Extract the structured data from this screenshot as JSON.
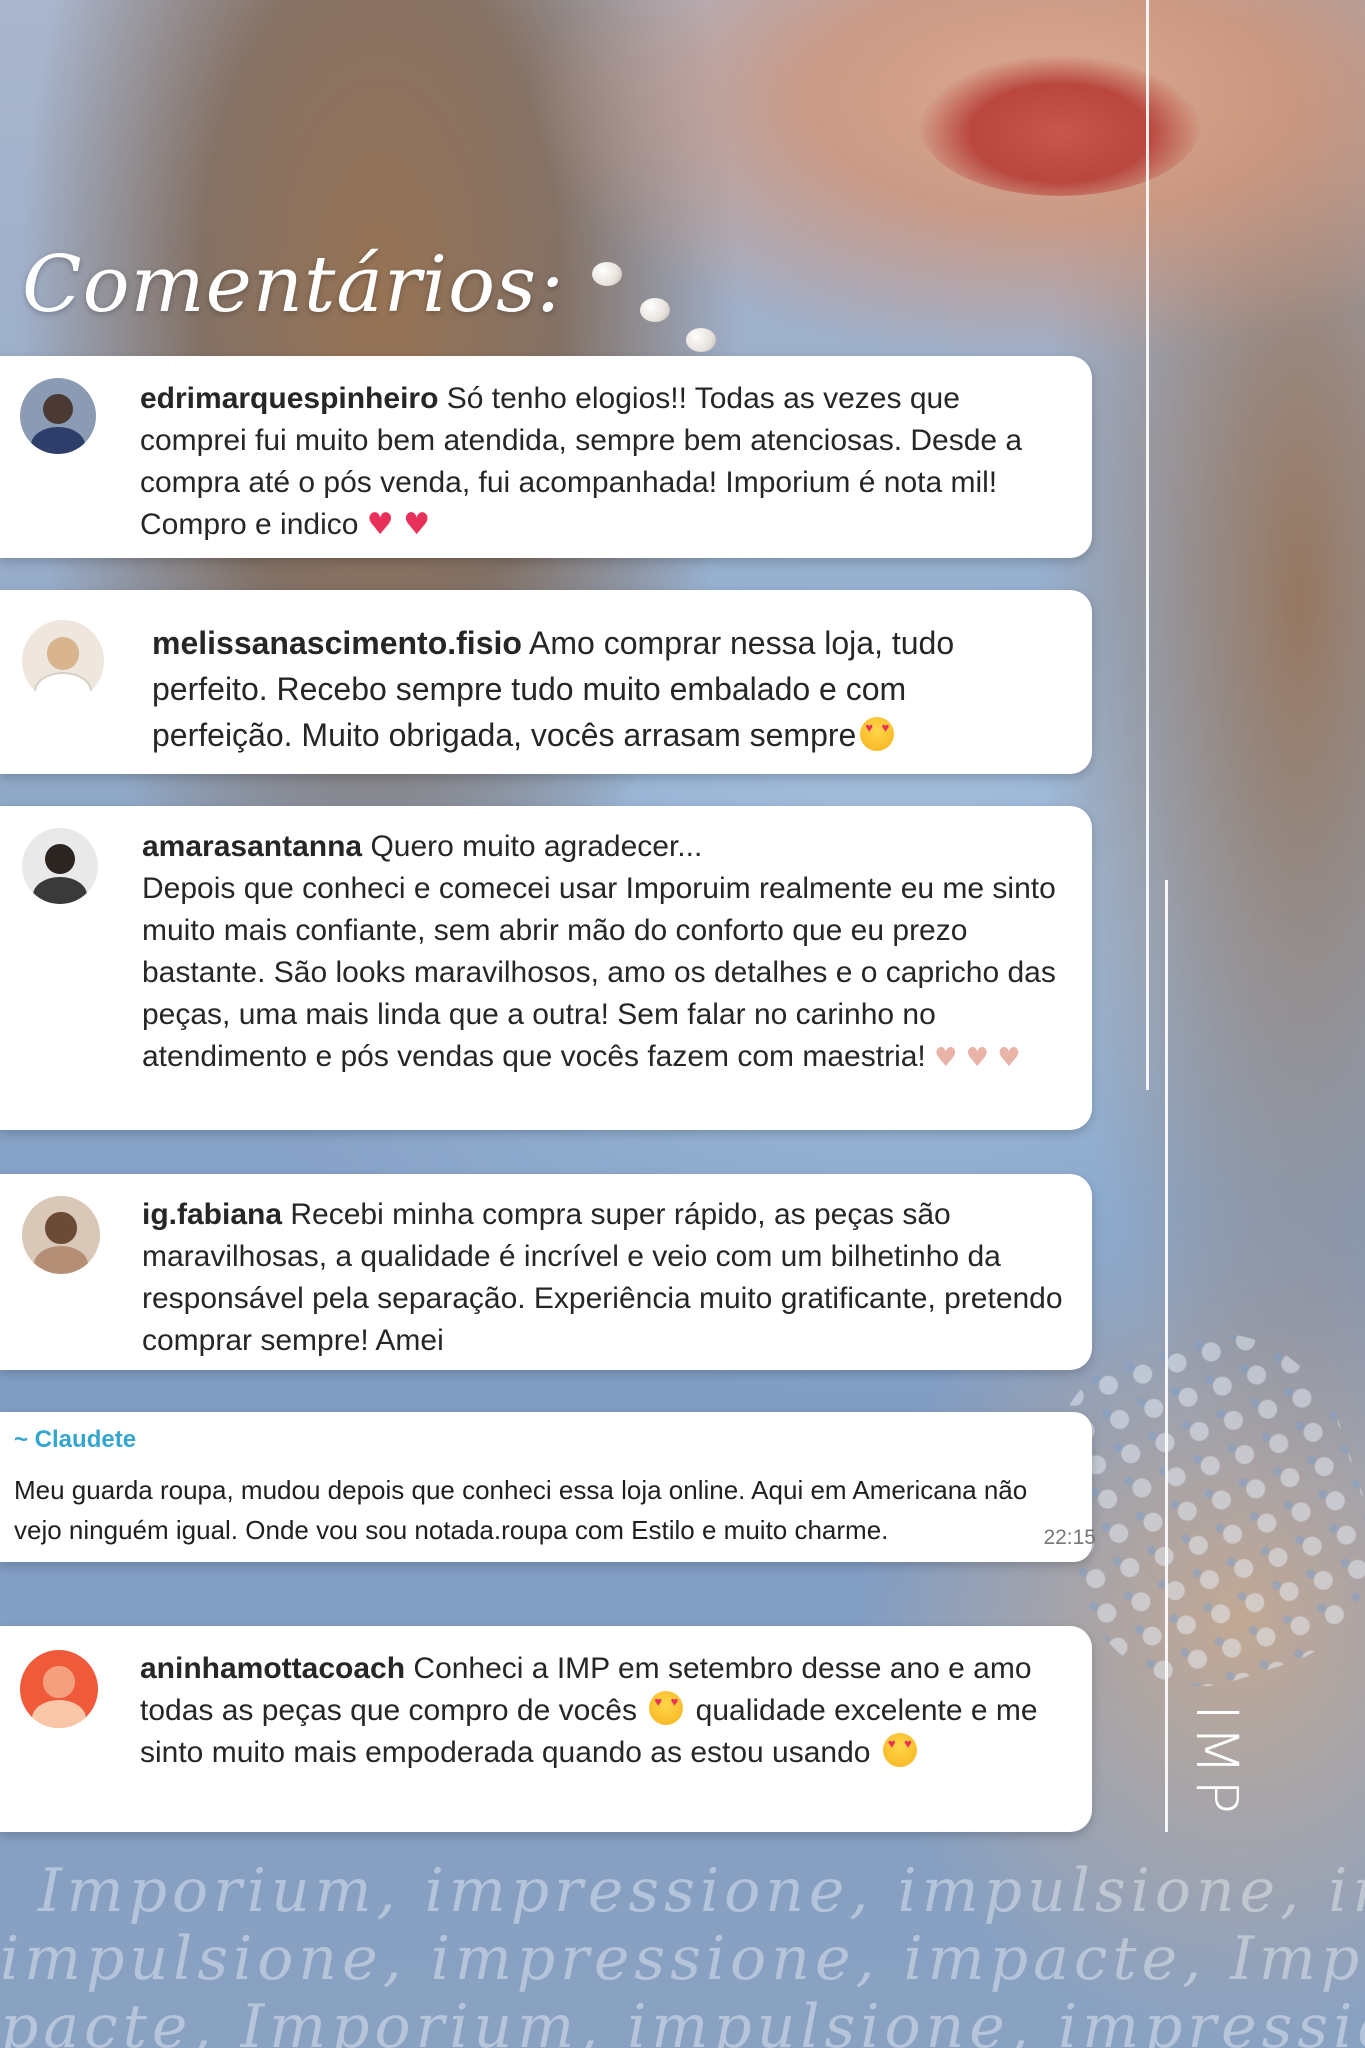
{
  "title": "Comentários:",
  "comments": [
    {
      "user": "edrimarquespinheiro",
      "text": " Só tenho elogios!! Todas as vezes que comprei fui muito bem atendida, sempre bem atenciosas. Desde a compra até o pós venda, fui acompanhada! Imporium é nota mil! Compro e indico ",
      "emoji": "♥ ♥"
    },
    {
      "user": "melissanascimento.fisio",
      "text": " Amo comprar nessa loja, tudo perfeito. Recebo sempre tudo muito embalado e com perfeição. Muito obrigada, vocês arrasam sempre"
    },
    {
      "user": "amarasantanna",
      "text": " Quero muito agradecer...",
      "text2": "Depois que conheci e comecei usar Imporuim realmente eu me sinto muito mais confiante, sem abrir mão do conforto que eu prezo bastante. São looks maravilhosos, amo os detalhes e o capricho das peças, uma mais linda que a outra! Sem falar no carinho no atendimento e pós vendas que vocês fazem com maestria! ",
      "emoji": "♥ ♥ ♥"
    },
    {
      "user": "ig.fabiana",
      "text": " Recebi minha compra super rápido, as peças são maravilhosas, a qualidade é incrível e veio com um bilhetinho da responsável pela separação. Experiência muito gratificante, pretendo comprar sempre! Amei"
    },
    {
      "user": "aninhamottacoach",
      "text": " Conheci a IMP em setembro desse ano e amo todas as peças que compro de vocês ",
      "text2": " qualidade excelente e me sinto muito mais empoderada quando as estou usando "
    }
  ],
  "message": {
    "sender": "~ Claudete",
    "text": "Meu guarda roupa, mudou depois que conheci essa loja online. Aqui em Americana não vejo ninguém igual. Onde vou sou notada.roupa com Estilo e muito charme.",
    "time": "22:15"
  },
  "brand": "IMP",
  "slogan": [
    "Imporium, impressione, impulsione, impacte,",
    "impulsione, impressione, impacte, Imporium,",
    "pacte, Imporium, impulsione, impressione, Im"
  ],
  "colors": {
    "card": "#ffffff",
    "username": "#262626",
    "sender": "#35a6cf"
  }
}
